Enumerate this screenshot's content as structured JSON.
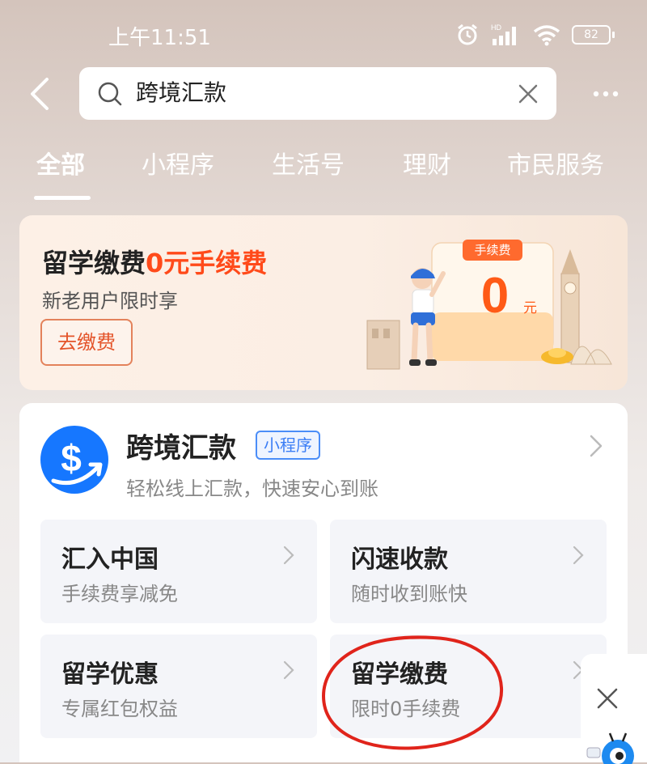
{
  "status_bar": {
    "time": "上午11:51",
    "signal_label": "HD",
    "battery": "82"
  },
  "search": {
    "query": "跨境汇款"
  },
  "tabs": [
    {
      "label": "全部",
      "active": true
    },
    {
      "label": "小程序"
    },
    {
      "label": "生活号"
    },
    {
      "label": "理财"
    },
    {
      "label": "市民服务"
    }
  ],
  "banner": {
    "title_prefix": "留学缴费",
    "title_highlight": "0元手续费",
    "subtitle": "新老用户限时享",
    "button": "去缴费",
    "badge": "手续费",
    "amount": "0",
    "unit": "元"
  },
  "app": {
    "name": "跨境汇款",
    "tag": "小程序",
    "description": "轻松线上汇款，快速安心到账",
    "services": [
      {
        "title": "汇入中国",
        "desc": "手续费享减免"
      },
      {
        "title": "闪速收款",
        "desc": "随时收到账快"
      },
      {
        "title": "留学优惠",
        "desc": "专属红包权益"
      },
      {
        "title": "留学缴费",
        "desc": "限时0手续费"
      }
    ]
  },
  "colors": {
    "accent": "#ff4a1a",
    "tag_blue": "#3a7df5",
    "annotation_red": "#e0241b"
  }
}
